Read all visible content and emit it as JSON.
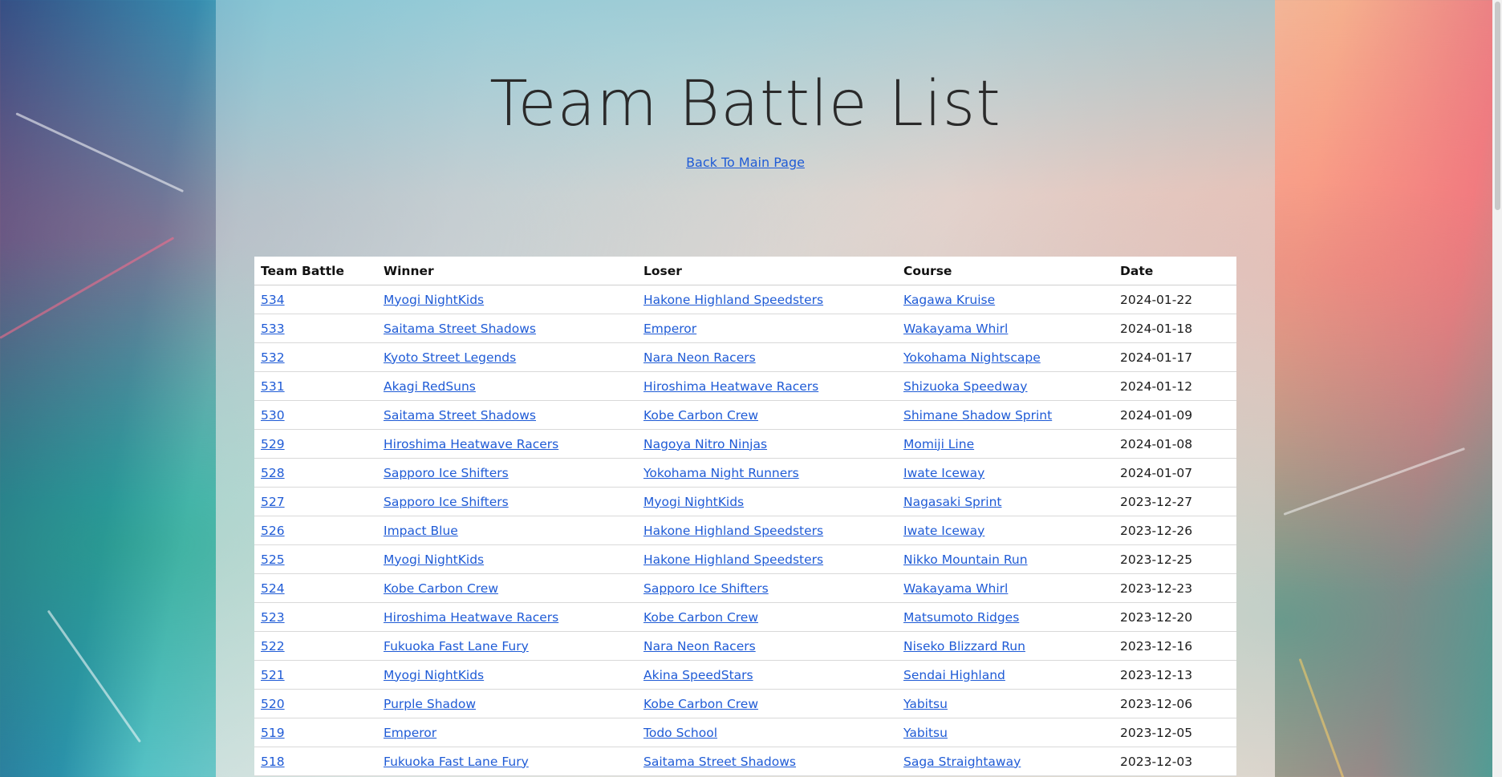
{
  "page": {
    "title": "Team Battle List",
    "back_link": "Back To Main Page"
  },
  "table": {
    "headers": [
      "Team Battle",
      "Winner",
      "Loser",
      "Course",
      "Date"
    ],
    "rows": [
      {
        "id": "534",
        "winner": "Myogi NightKids",
        "loser": "Hakone Highland Speedsters",
        "course": "Kagawa Kruise",
        "date": "2024-01-22"
      },
      {
        "id": "533",
        "winner": "Saitama Street Shadows",
        "loser": "Emperor",
        "course": "Wakayama Whirl",
        "date": "2024-01-18"
      },
      {
        "id": "532",
        "winner": "Kyoto Street Legends",
        "loser": "Nara Neon Racers",
        "course": "Yokohama Nightscape",
        "date": "2024-01-17"
      },
      {
        "id": "531",
        "winner": "Akagi RedSuns",
        "loser": "Hiroshima Heatwave Racers",
        "course": "Shizuoka Speedway",
        "date": "2024-01-12"
      },
      {
        "id": "530",
        "winner": "Saitama Street Shadows",
        "loser": "Kobe Carbon Crew",
        "course": "Shimane Shadow Sprint",
        "date": "2024-01-09"
      },
      {
        "id": "529",
        "winner": "Hiroshima Heatwave Racers",
        "loser": "Nagoya Nitro Ninjas",
        "course": "Momiji Line",
        "date": "2024-01-08"
      },
      {
        "id": "528",
        "winner": "Sapporo Ice Shifters",
        "loser": "Yokohama Night Runners",
        "course": "Iwate Iceway",
        "date": "2024-01-07"
      },
      {
        "id": "527",
        "winner": "Sapporo Ice Shifters",
        "loser": "Myogi NightKids",
        "course": "Nagasaki Sprint",
        "date": "2023-12-27"
      },
      {
        "id": "526",
        "winner": "Impact Blue",
        "loser": "Hakone Highland Speedsters",
        "course": "Iwate Iceway",
        "date": "2023-12-26"
      },
      {
        "id": "525",
        "winner": "Myogi NightKids",
        "loser": "Hakone Highland Speedsters",
        "course": "Nikko Mountain Run",
        "date": "2023-12-25"
      },
      {
        "id": "524",
        "winner": "Kobe Carbon Crew",
        "loser": "Sapporo Ice Shifters",
        "course": "Wakayama Whirl",
        "date": "2023-12-23"
      },
      {
        "id": "523",
        "winner": "Hiroshima Heatwave Racers",
        "loser": "Kobe Carbon Crew",
        "course": "Matsumoto Ridges",
        "date": "2023-12-20"
      },
      {
        "id": "522",
        "winner": "Fukuoka Fast Lane Fury",
        "loser": "Nara Neon Racers",
        "course": "Niseko Blizzard Run",
        "date": "2023-12-16"
      },
      {
        "id": "521",
        "winner": "Myogi NightKids",
        "loser": "Akina SpeedStars",
        "course": "Sendai Highland",
        "date": "2023-12-13"
      },
      {
        "id": "520",
        "winner": "Purple Shadow",
        "loser": "Kobe Carbon Crew",
        "course": "Yabitsu",
        "date": "2023-12-06"
      },
      {
        "id": "519",
        "winner": "Emperor",
        "loser": "Todo School",
        "course": "Yabitsu",
        "date": "2023-12-05"
      },
      {
        "id": "518",
        "winner": "Fukuoka Fast Lane Fury",
        "loser": "Saitama Street Shadows",
        "course": "Saga Straightaway",
        "date": "2023-12-03"
      }
    ]
  },
  "colors": {
    "link": "#1f5bd6",
    "title": "#2a2a2a",
    "table_bg": "#ffffff"
  }
}
